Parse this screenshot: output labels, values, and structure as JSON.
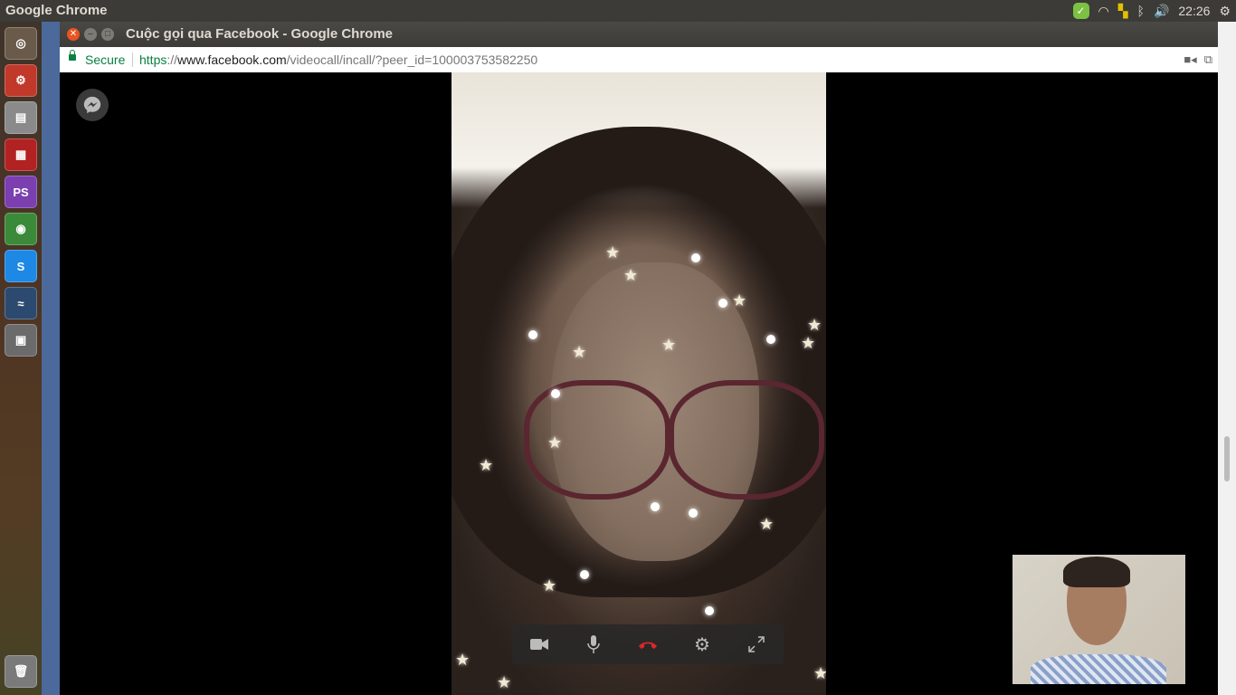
{
  "system": {
    "app_name": "Google Chrome",
    "clock": "22:26"
  },
  "window": {
    "title": "Cuộc gọi qua Facebook - Google Chrome"
  },
  "address_bar": {
    "security_label": "Secure",
    "url_scheme": "https",
    "url_sep": "://",
    "url_host": "www.facebook.com",
    "url_path": "/videocall/incall/?peer_id=100003753582250"
  },
  "launcher": {
    "items": [
      {
        "name": "ubuntu-dash",
        "glyph": "◎",
        "color": "#6a5a4a"
      },
      {
        "name": "settings-tools",
        "glyph": "⚙",
        "color": "#c0392b"
      },
      {
        "name": "files",
        "glyph": "▤",
        "color": "#8a8a8a"
      },
      {
        "name": "presentation",
        "glyph": "▦",
        "color": "#b22222"
      },
      {
        "name": "phpstorm",
        "glyph": "PS",
        "color": "#7b3fb0"
      },
      {
        "name": "chrome",
        "glyph": "◉",
        "color": "#3a8a3a"
      },
      {
        "name": "skype",
        "glyph": "S",
        "color": "#1e88e5"
      },
      {
        "name": "mysql-workbench",
        "glyph": "≈",
        "color": "#2c4a70"
      },
      {
        "name": "workspaces",
        "glyph": "▣",
        "color": "#6b6b6b"
      }
    ]
  },
  "call": {
    "controls": [
      "camera",
      "microphone",
      "end-call",
      "settings",
      "fullscreen"
    ],
    "end_call_color": "#e0262b"
  }
}
